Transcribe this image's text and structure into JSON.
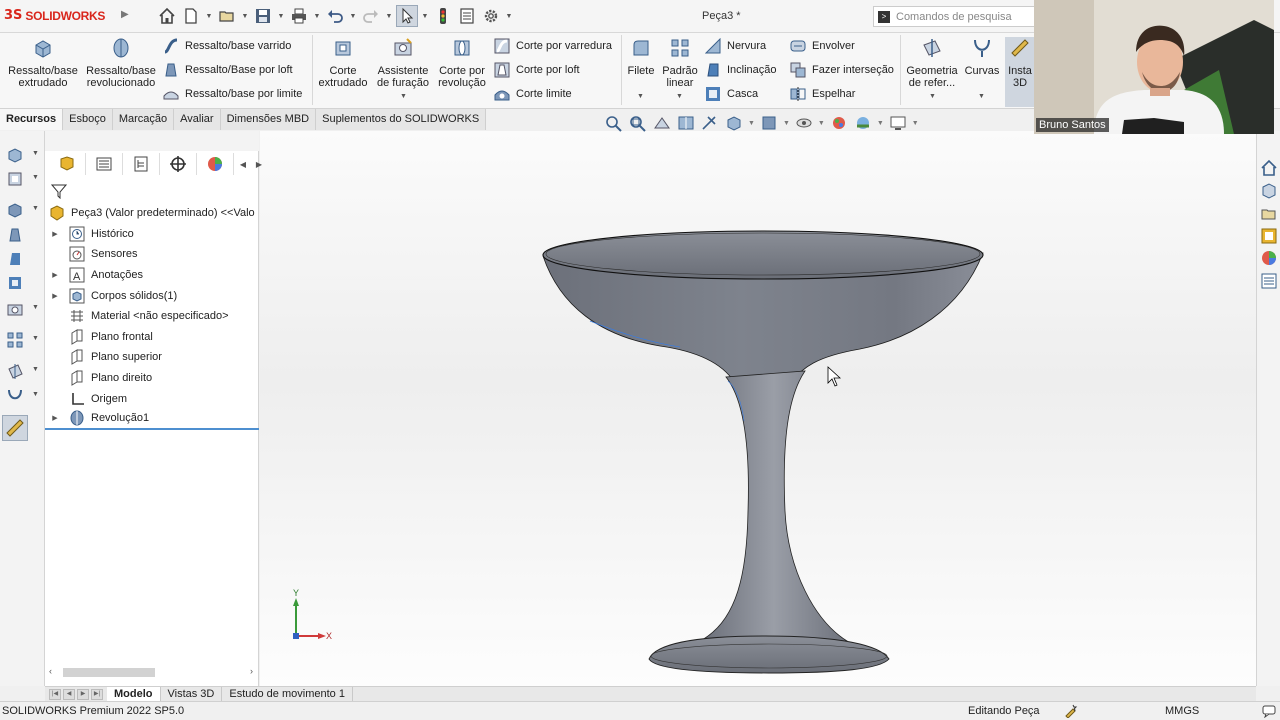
{
  "titlebar": {
    "brand_prefix": "3S",
    "brand_name": "SOLIDWORKS",
    "document_title": "Peça3 *",
    "search_placeholder": "Comandos de pesquisa"
  },
  "ribbon": {
    "items": [
      {
        "label_line1": "Ressalto/base",
        "label_line2": "extrudado"
      },
      {
        "label_line1": "Ressalto/base",
        "label_line2": "revolucionado"
      },
      {
        "label": "Ressalto/base varrido"
      },
      {
        "label": "Ressalto/Base por loft"
      },
      {
        "label": "Ressalto/base por limite"
      },
      {
        "label_line1": "Corte",
        "label_line2": "extrudado"
      },
      {
        "label_line1": "Assistente",
        "label_line2": "de furação"
      },
      {
        "label_line1": "Corte por",
        "label_line2": "revolução"
      },
      {
        "label": "Corte por varredura"
      },
      {
        "label": "Corte por loft"
      },
      {
        "label": "Corte limite"
      },
      {
        "label_line1": "Filete",
        "label_line2": ""
      },
      {
        "label_line1": "Padrão",
        "label_line2": "linear"
      },
      {
        "label": "Nervura"
      },
      {
        "label": "Inclinação"
      },
      {
        "label": "Casca"
      },
      {
        "label": "Envolver"
      },
      {
        "label": "Fazer interseção"
      },
      {
        "label": "Espelhar"
      },
      {
        "label_line1": "Geometria",
        "label_line2": "de refer..."
      },
      {
        "label_line1": "Curvas",
        "label_line2": ""
      },
      {
        "label_line1": "Insta",
        "label_line2": "3D"
      }
    ]
  },
  "command_tabs": [
    "Recursos",
    "Esboço",
    "Marcação",
    "Avaliar",
    "Dimensões MBD",
    "Suplementos do SOLIDWORKS"
  ],
  "feature_tree": {
    "root": "Peça3  (Valor predeterminado) <<Valo",
    "items": [
      {
        "label": "Histórico",
        "expandable": true
      },
      {
        "label": "Sensores",
        "expandable": false
      },
      {
        "label": "Anotações",
        "expandable": true
      },
      {
        "label": "Corpos sólidos(1)",
        "expandable": true
      },
      {
        "label": "Material <não especificado>",
        "expandable": false
      },
      {
        "label": "Plano frontal",
        "expandable": false
      },
      {
        "label": "Plano superior",
        "expandable": false
      },
      {
        "label": "Plano direito",
        "expandable": false
      },
      {
        "label": "Origem",
        "expandable": false
      },
      {
        "label": "Revolução1",
        "expandable": true
      }
    ]
  },
  "triad": {
    "y_label": "Y",
    "x_label": "X"
  },
  "bottom_tabs": [
    "Modelo",
    "Vistas 3D",
    "Estudo de movimento 1"
  ],
  "status": {
    "version": "SOLIDWORKS Premium 2022 SP5.0",
    "mode": "Editando Peça",
    "units": "MMGS"
  },
  "webcam": {
    "name": "Bruno Santos"
  },
  "colors": {
    "brand_red": "#d9261c",
    "model_body": "#7a7e88",
    "selection_blue": "#1c6fd0"
  }
}
